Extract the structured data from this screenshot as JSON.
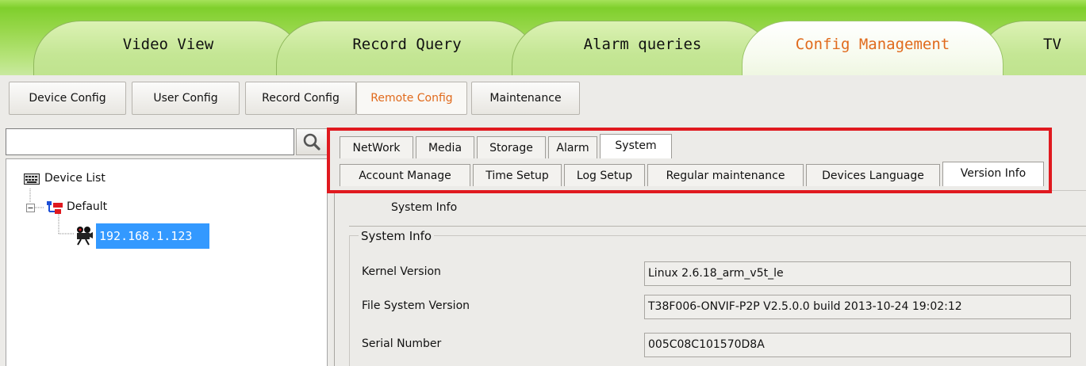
{
  "main_tabs": [
    {
      "label": "Video View"
    },
    {
      "label": "Record Query"
    },
    {
      "label": "Alarm queries"
    },
    {
      "label": "Config Management"
    },
    {
      "label": "TV"
    }
  ],
  "sub_menu": [
    {
      "label": "Device Config"
    },
    {
      "label": "User Config"
    },
    {
      "label": "Record Config"
    },
    {
      "label": "Remote Config"
    },
    {
      "label": "Maintenance"
    }
  ],
  "search": {
    "value": ""
  },
  "tree": {
    "root": "Device List",
    "group": "Default",
    "device": "192.168.1.123"
  },
  "config_tabs_row1": [
    {
      "label": "NetWork"
    },
    {
      "label": "Media"
    },
    {
      "label": "Storage"
    },
    {
      "label": "Alarm"
    },
    {
      "label": "System"
    }
  ],
  "config_tabs_row2": [
    {
      "label": "Account Manage"
    },
    {
      "label": "Time Setup"
    },
    {
      "label": "Log Setup"
    },
    {
      "label": "Regular maintenance"
    },
    {
      "label": "Devices Language"
    },
    {
      "label": "Version Info"
    }
  ],
  "section_tab": "System Info",
  "group_title": "System Info",
  "info_rows": [
    {
      "label": "Kernel Version",
      "value": "Linux 2.6.18_arm_v5t_le"
    },
    {
      "label": "File System Version",
      "value": "T38F006-ONVIF-P2P V2.5.0.0 build 2013-10-24 19:02:12"
    },
    {
      "label": "Serial Number",
      "value": "005C08C101570D8A"
    }
  ],
  "colors": {
    "accent": "#e06a1c",
    "highlight_box": "#e0191f",
    "selection": "#3399ff",
    "topbar": "#8fd43c"
  }
}
